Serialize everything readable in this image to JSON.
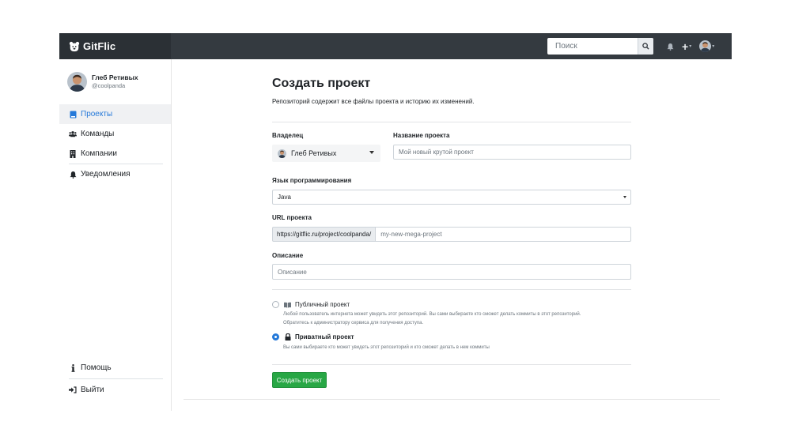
{
  "app": {
    "name": "GitFlic"
  },
  "header": {
    "search_placeholder": "Поиск",
    "plus_label": "+",
    "caret": "▾"
  },
  "user": {
    "name": "Глеб Ретивых",
    "handle": "@coolpanda"
  },
  "sidebar": {
    "items": [
      {
        "label": "Проекты",
        "icon": "repo-icon",
        "active": true
      },
      {
        "label": "Команды",
        "icon": "users-icon",
        "active": false
      },
      {
        "label": "Компании",
        "icon": "building-icon",
        "active": false
      },
      {
        "label": "Уведомления",
        "icon": "bell-icon",
        "active": false
      }
    ],
    "bottom_items": [
      {
        "label": "Помощь",
        "icon": "info-icon"
      },
      {
        "label": "Выйти",
        "icon": "sign-out-icon"
      }
    ]
  },
  "form": {
    "title": "Создать проект",
    "subtitle": "Репозиторий содержит все файлы проекта и историю их изменений.",
    "owner_label": "Владелец",
    "owner_value": "Глеб Ретивых",
    "name_label": "Название проекта",
    "name_placeholder": "Мой новый крутой проект",
    "language_label": "Язык программирования",
    "language_value": "Java",
    "url_label": "URL проекта",
    "url_prefix": "https://gitflic.ru/project/coolpanda/",
    "url_placeholder": "my-new-mega-project",
    "description_label": "Описание",
    "description_placeholder": "Описание",
    "visibility": {
      "public_title": "Публичный проект",
      "public_desc_line1": "Любой пользователь интернета может увидеть этот репозиторий. Вы сами выбираете кто сможет делать коммиты в этот репозиторий.",
      "public_desc_line2": "Обратитесь к администратору сервиса для получения доступа.",
      "private_title": "Приватный проект",
      "private_desc": "Вы сами выбираете кто может увидеть этот репозиторий и кто сможет делать в нем коммиты",
      "selected": "private"
    },
    "submit_label": "Создать проект"
  },
  "colors": {
    "topbar": "#343a40",
    "brand_bg": "#2b3035",
    "accent": "#2579d9",
    "success": "#28a745"
  }
}
